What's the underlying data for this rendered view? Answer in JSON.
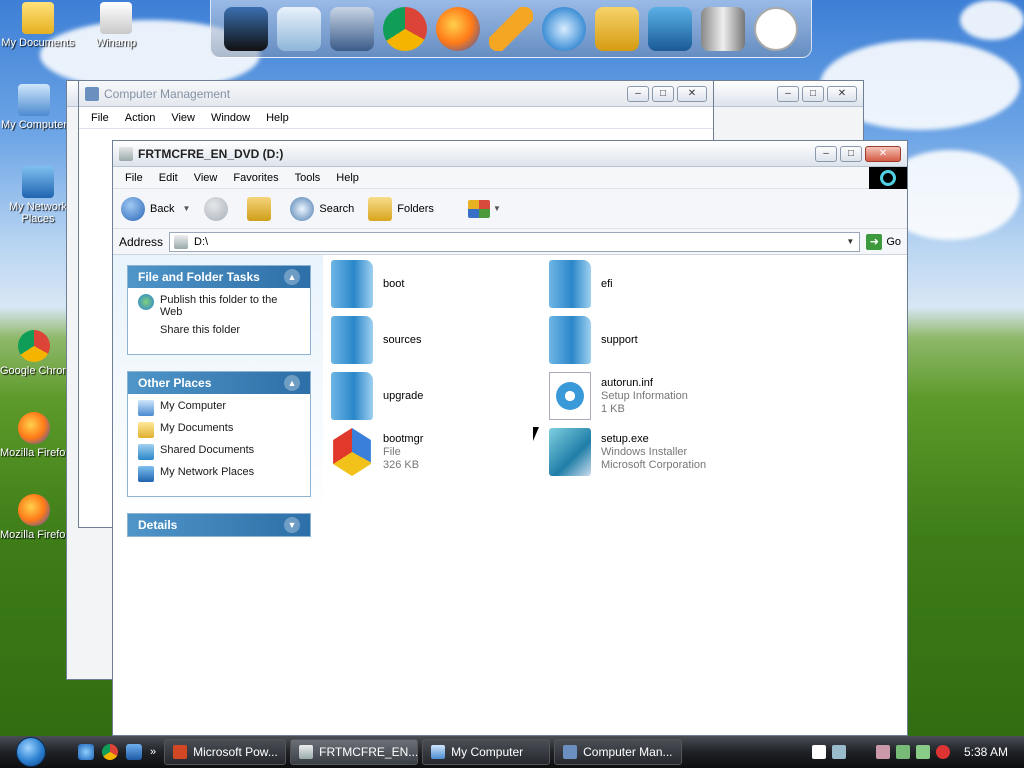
{
  "desktop": {
    "icons": [
      {
        "label": "My Documents"
      },
      {
        "label": "Winamp"
      },
      {
        "label": "My Computer"
      },
      {
        "label": "My Network Places"
      },
      {
        "label": "Google Chrome"
      },
      {
        "label": "Mozilla Firefox"
      },
      {
        "label": "Mozilla Firefox"
      }
    ]
  },
  "dock": {
    "items": [
      "monitor-icon",
      "search-document-icon",
      "tools-icon",
      "chrome-icon",
      "firefox-icon",
      "lightning-icon",
      "magnifier-icon",
      "letter-f-icon",
      "monitor-blue-icon",
      "trash-icon",
      "clock-icon"
    ]
  },
  "computer_management": {
    "title": "Computer Management",
    "menu": [
      "File",
      "Action",
      "View",
      "Window",
      "Help"
    ]
  },
  "explorer": {
    "title": "FRTMCFRE_EN_DVD (D:)",
    "menu": [
      "File",
      "Edit",
      "View",
      "Favorites",
      "Tools",
      "Help"
    ],
    "toolbar": {
      "back": "Back",
      "search": "Search",
      "folders": "Folders"
    },
    "address": {
      "label": "Address",
      "value": "D:\\",
      "go": "Go"
    },
    "tasks": {
      "file_folder": {
        "title": "File and Folder Tasks",
        "items": [
          "Publish this folder to the Web",
          "Share this folder"
        ]
      },
      "other_places": {
        "title": "Other Places",
        "items": [
          "My Computer",
          "My Documents",
          "Shared Documents",
          "My Network Places"
        ]
      },
      "details": {
        "title": "Details"
      }
    },
    "files": [
      {
        "name": "boot",
        "line2": "",
        "line3": ""
      },
      {
        "name": "efi",
        "line2": "",
        "line3": ""
      },
      {
        "name": "sources",
        "line2": "",
        "line3": ""
      },
      {
        "name": "support",
        "line2": "",
        "line3": ""
      },
      {
        "name": "upgrade",
        "line2": "",
        "line3": ""
      },
      {
        "name": "autorun.inf",
        "line2": "Setup Information",
        "line3": "1 KB"
      },
      {
        "name": "bootmgr",
        "line2": "File",
        "line3": "326 KB"
      },
      {
        "name": "setup.exe",
        "line2": "Windows Installer",
        "line3": "Microsoft Corporation"
      }
    ]
  },
  "taskbar": {
    "buttons": [
      "Microsoft Pow...",
      "FRTMCFRE_EN...",
      "My Computer",
      "Computer Man..."
    ],
    "clock": "5:38 AM"
  }
}
